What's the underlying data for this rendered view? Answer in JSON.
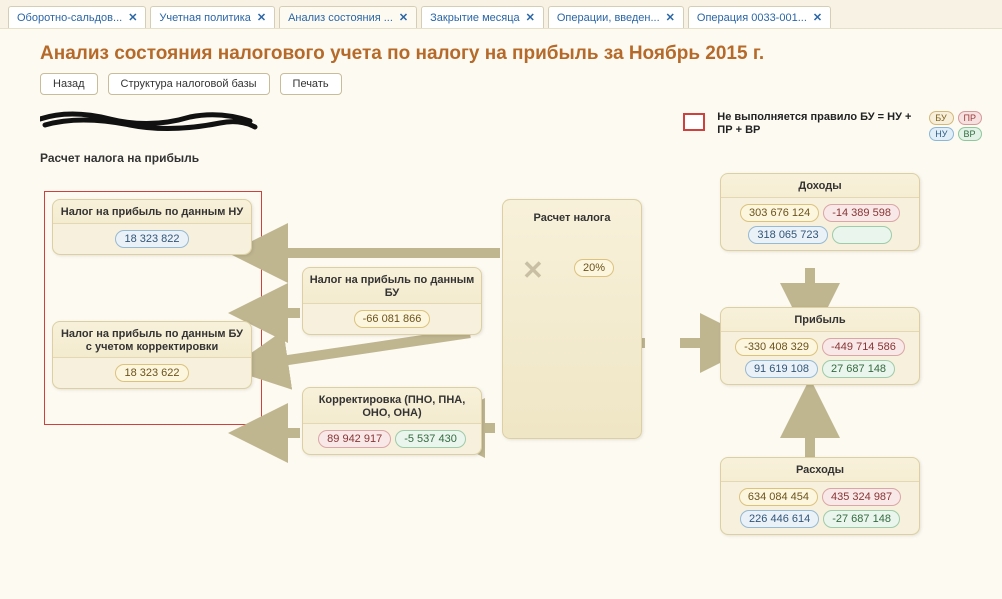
{
  "tabs": [
    {
      "label": "Оборотно-сальдов..."
    },
    {
      "label": "Учетная политика"
    },
    {
      "label": "Анализ состояния ...",
      "active": true
    },
    {
      "label": "Закрытие месяца"
    },
    {
      "label": "Операции, введен..."
    },
    {
      "label": "Операция 0033-001..."
    }
  ],
  "title": "Анализ состояния налогового учета по налогу на прибыль за Ноябрь 2015 г.",
  "toolbar": {
    "back": "Назад",
    "structure": "Структура налоговой базы",
    "print": "Печать"
  },
  "subtitle": "Расчет налога на прибыль",
  "legend": {
    "rule_text": "Не выполняется правило БУ = НУ + ПР + ВР",
    "pills": {
      "bu": "БУ",
      "pr": "ПР",
      "nu": "НУ",
      "vr": "ВР"
    }
  },
  "cards": {
    "nu_tax": {
      "title": "Налог на прибыль по данным НУ",
      "v1": "18 323 822"
    },
    "bu_corr": {
      "title": "Налог на прибыль по данным БУ с учетом корректировки",
      "v1": "18 323 622"
    },
    "bu_tax": {
      "title": "Налог на прибыль по данным БУ",
      "v1": "-66 081 866"
    },
    "corr": {
      "title": "Корректировка (ПНО, ПНА, ОНО, ОНА)",
      "v1": "89 942 917",
      "v2": "-5 537 430"
    },
    "calc": {
      "title": "Расчет налога",
      "rate": "20%"
    },
    "income": {
      "title": "Доходы",
      "v1": "303 676 124",
      "v2": "-14 389 598",
      "v3": "318 065 723"
    },
    "profit": {
      "title": "Прибыль",
      "v1": "-330 408 329",
      "v2": "-449 714 586",
      "v3": "91 619 108",
      "v4": "27 687 148"
    },
    "expense": {
      "title": "Расходы",
      "v1": "634 084 454",
      "v2": "435 324 987",
      "v3": "226 446 614",
      "v4": "-27 687 148"
    }
  }
}
